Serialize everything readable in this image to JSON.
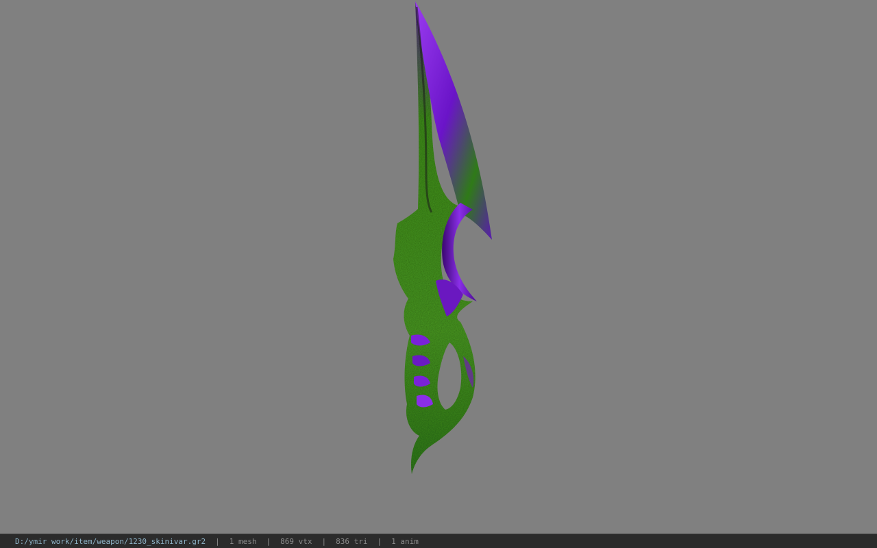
{
  "viewport": {
    "background_color": "#808080",
    "model_colors": {
      "blade_purple": "#7a1fd6",
      "blade_purple_dark": "#3d0a70",
      "texture_green": "#3f8f1a",
      "texture_green_dark": "#1f5210"
    }
  },
  "statusbar": {
    "file_path": "D:/ymir work/item/weapon/1230_skinivar.gr2",
    "separator": "|",
    "mesh_count": "1 mesh",
    "vertex_count": "869 vtx",
    "triangle_count": "836 tri",
    "anim_count": "1 anim",
    "path_color": "#8fb4c8",
    "text_color": "#8c8c8c"
  }
}
